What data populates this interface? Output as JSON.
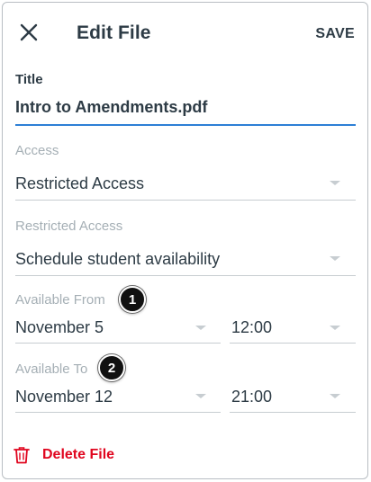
{
  "toolbar": {
    "title": "Edit File",
    "save_label": "SAVE"
  },
  "form": {
    "title_label": "Title",
    "title_value": "Intro to Amendments.pdf",
    "access_label": "Access",
    "access_value": "Restricted Access",
    "restricted_label": "Restricted Access",
    "restricted_value": "Schedule student availability",
    "available_from_label": "Available From",
    "available_from_date": "November 5",
    "available_from_time": "12:00",
    "available_to_label": "Available To",
    "available_to_date": "November 12",
    "available_to_time": "21:00"
  },
  "callouts": [
    "1",
    "2"
  ],
  "delete": {
    "label": "Delete File"
  },
  "colors": {
    "accent": "#2d7fd6",
    "danger": "#e0061f",
    "text": "#2d3b45",
    "muted": "#a5afb5"
  },
  "icons": {
    "close": "close-icon",
    "trash": "trash-icon",
    "dropdown": "caret-down-icon"
  }
}
